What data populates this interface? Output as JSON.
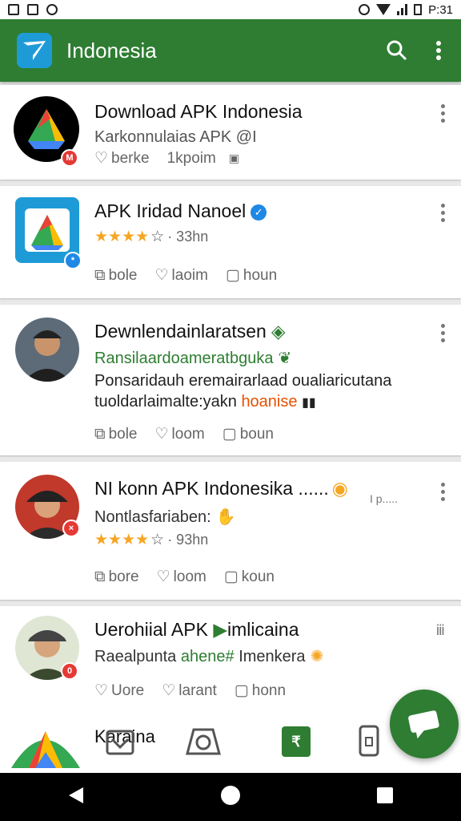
{
  "status_bar": {
    "time": "P:31"
  },
  "app_bar": {
    "title": "Indonesia",
    "search_icon": "search-icon",
    "more_icon": "more-vert-icon"
  },
  "feed": [
    {
      "title": "Download APK Indonesia",
      "subtitle": "Karkonnulaias APK @I",
      "actions": [
        "berke",
        "1kpoim"
      ]
    },
    {
      "title": "APK Iridad Nanoel",
      "rating_text": "· 33hn",
      "actions": [
        "bole",
        "laoim",
        "houn"
      ]
    },
    {
      "title": "Dewnlendainlaratsen",
      "subtitle": "Ransilaardoameratbguka",
      "body_line1": "Ponsaridauh eremairarlaad oualiaricutana",
      "body_line2": "tuoldarlaimalte:yakn",
      "body_highlight": "hoanise",
      "actions": [
        "bole",
        "loom",
        "boun"
      ]
    },
    {
      "title": "NI konn APK Indonesika ......",
      "trailing": "I p.....",
      "subtitle": "Nontlasfariaben:",
      "rating_text": "· 93hn",
      "actions": [
        "bore",
        "loom",
        "koun"
      ]
    },
    {
      "title": "Uerohiial APK",
      "title_suffix": "imlicaina",
      "subtitle_a": "Raealpunta",
      "subtitle_b": "ahene#",
      "subtitle_c": "Imenkera",
      "actions": [
        "Uore",
        "larant",
        "honn"
      ]
    }
  ],
  "bottom_nav": {
    "label": "Karaina"
  },
  "colors": {
    "primary": "#2e7d32",
    "accent": "#1e88e5",
    "star": "#f5a623",
    "badge_red": "#e53935"
  }
}
